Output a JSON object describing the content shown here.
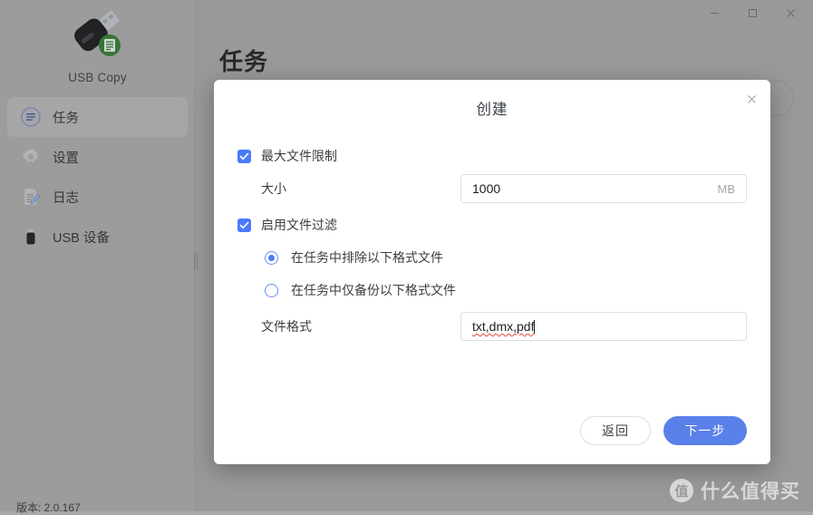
{
  "window": {
    "controls": [
      {
        "name": "minimize",
        "glyph": "minimize-icon"
      },
      {
        "name": "maximize",
        "glyph": "maximize-icon"
      },
      {
        "name": "close",
        "glyph": "close-icon"
      }
    ]
  },
  "sidebar": {
    "app_name": "USB Copy",
    "logo_icon": "usb-drive-icon",
    "version": "版本: 2.0.167",
    "items": [
      {
        "label": "任务",
        "icon": "task-list-icon",
        "active": true
      },
      {
        "label": "设置",
        "icon": "gear-icon",
        "active": false
      },
      {
        "label": "日志",
        "icon": "log-edit-icon",
        "active": false
      },
      {
        "label": "USB 设备",
        "icon": "usb-device-icon",
        "active": false
      }
    ]
  },
  "content": {
    "page_title": "任务",
    "add_button_icon": "add-circle-icon"
  },
  "dialog": {
    "title": "创建",
    "close_icon": "close-icon",
    "max_file_limit": {
      "label": "最大文件限制",
      "checked": true
    },
    "size": {
      "label": "大小",
      "value": "1000",
      "unit": "MB",
      "placeholder": "1000"
    },
    "file_filter": {
      "label": "启用文件过滤",
      "checked": true,
      "options": [
        {
          "label": "在任务中排除以下格式文件",
          "selected": true
        },
        {
          "label": "在任务中仅备份以下格式文件",
          "selected": false
        }
      ]
    },
    "file_format": {
      "label": "文件格式",
      "value": "txt,dmx,pdf",
      "placeholder": "txt,dmx,pdf"
    },
    "buttons": {
      "back": "返回",
      "next": "下一步"
    }
  },
  "watermark": {
    "badge": "值",
    "text": "什么值得买"
  },
  "colors": {
    "accent_blue": "#4a7afc",
    "primary_button": "#5a80ea",
    "app_background": "#a8a8a8",
    "sidebar_background": "#ababab",
    "sidebar_active": "#b8b8b8",
    "dialog_background": "#ffffff",
    "spellcheck_underline": "#e04a3f"
  }
}
